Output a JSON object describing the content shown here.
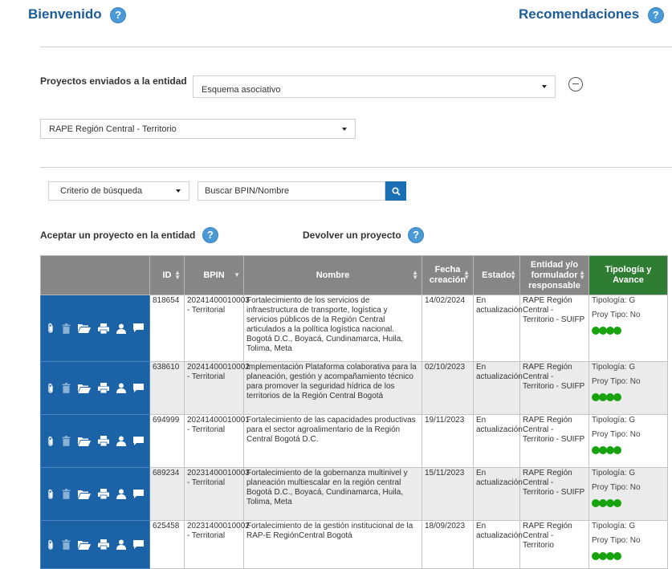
{
  "header": {
    "welcome_label": "Bienvenido",
    "recommendations_label": "Recomendaciones"
  },
  "filters": {
    "projects_sent_label": "Proyectos enviados a la entidad",
    "scheme_select_value": "Esquema asociativo",
    "entity_select_value": "RAPE Región Central - Territorio",
    "criteria_select_value": "Criterio de búsqueda",
    "search_placeholder": "Buscar BPIN/Nombre"
  },
  "actions": {
    "accept_label": "Aceptar un proyecto en la entidad",
    "return_label": "Devolver un proyecto"
  },
  "table": {
    "headers": {
      "id": "ID",
      "bpin": "BPIN",
      "nombre": "Nombre",
      "fecha": "Fecha creación",
      "estado": "Estado",
      "entidad": "Entidad y/o formulador responsable",
      "tipologia": "Tipología y Avance"
    },
    "rows": [
      {
        "id": "818654",
        "bpin": "20241400010003 - Territorial",
        "nombre": "Fortalecimiento de los servicios de infraestructura de transporte, logística y servicios públicos de la Región Central articulados a la política logística nacional.  Bogotá D.C., Boyacá, Cundinamarca, Huila, Tolima, Meta",
        "fecha": "14/02/2024",
        "estado": "En actualización",
        "entidad": "RAPE Región Central - Territorio - SUIFP",
        "tipologia": "Tipología: G",
        "proy_tipo": "Proy Tipo: No"
      },
      {
        "id": "638610",
        "bpin": "20241400010002 - Territorial",
        "nombre": "Implementación Plataforma colaborativa para la planeación, gestión y acompañamiento técnico para promover la seguridad hídrica de los territorios de la Región Central  Bogotá",
        "fecha": "02/10/2023",
        "estado": "En actualización",
        "entidad": "RAPE Región Central - Territorio - SUIFP",
        "tipologia": "Tipología: G",
        "proy_tipo": "Proy Tipo: No"
      },
      {
        "id": "694999",
        "bpin": "20241400010001 - Territorial",
        "nombre": "Fortalecimiento de las capacidades productivas para el sector agroalimentario de la Región Central Bogotá D.C.",
        "fecha": "19/11/2023",
        "estado": "En actualización",
        "entidad": "RAPE Región Central - Territorio - SUIFP",
        "tipologia": "Tipología: G",
        "proy_tipo": "Proy Tipo: No"
      },
      {
        "id": "689234",
        "bpin": "20231400010003 - Territorial",
        "nombre": "Fortalecimiento de la gobernanza multinivel y planeación multiescalar en la región central  Bogotá D.C., Boyacá, Cundinamarca, Huila, Tolima, Meta",
        "fecha": "15/11/2023",
        "estado": "En actualización",
        "entidad": "RAPE Región Central - Territorio - SUIFP",
        "tipologia": "Tipología: G",
        "proy_tipo": "Proy Tipo: No"
      },
      {
        "id": "625458",
        "bpin": "20231400010002 - Territorial",
        "nombre": "Fortalecimiento de la gestión institucional de la RAP-E RegiónCentral  Bogotá",
        "fecha": "18/09/2023",
        "estado": "En actualización",
        "entidad": "RAPE Región Central - Territorio",
        "tipologia": "Tipología: G",
        "proy_tipo": "Proy Tipo: No"
      }
    ]
  },
  "icons": [
    "help-icon",
    "paperclip-icon",
    "trash-icon",
    "folder-open-icon",
    "print-icon",
    "user-icon",
    "comment-icon",
    "search-icon",
    "minus-circle-icon",
    "caret-down-icon",
    "sort-icon"
  ],
  "colors": {
    "brand_blue": "#1d5d97",
    "action_blue": "#1b63a6",
    "header_gray": "#868686",
    "tipologia_green": "#2e7d32",
    "progress_green": "#18a30e"
  }
}
